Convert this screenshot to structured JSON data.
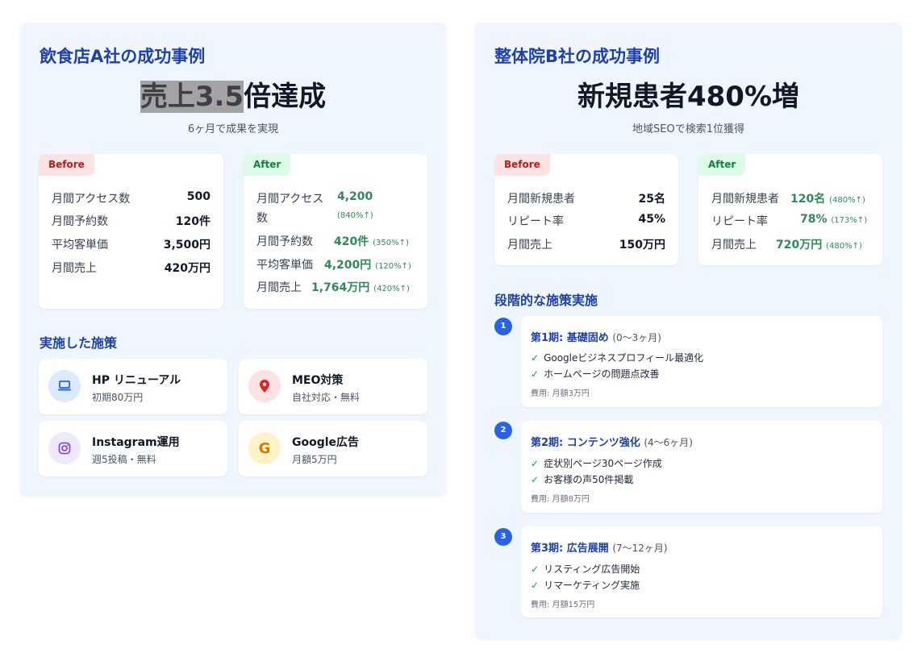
{
  "case_a": {
    "title": "飲食店A社の成功事例",
    "headline_highlight": "売上3.5",
    "headline_rest": "倍達成",
    "subline": "6ヶ月で成果を実現",
    "before": {
      "badge": "Before",
      "rows": [
        {
          "label": "月間アクセス数",
          "value": "500"
        },
        {
          "label": "月間予約数",
          "value": "120件"
        },
        {
          "label": "平均客単価",
          "value": "3,500円"
        },
        {
          "label": "月間売上",
          "value": "420万円"
        }
      ]
    },
    "after": {
      "badge": "After",
      "rows": [
        {
          "label_line1": "月間アクセス",
          "label_line2": "数",
          "value": "4,200",
          "pct": "(840%↑)"
        },
        {
          "label": "月間予約数",
          "value": "420件",
          "pct": "(350%↑)"
        },
        {
          "label": "平均客単価",
          "value": "4,200円",
          "pct": "(120%↑)"
        },
        {
          "label": "月間売上",
          "value": "1,764万円",
          "pct": "(420%↑)"
        }
      ]
    },
    "measures_title": "実施した施策",
    "measures": [
      {
        "name": "HP リニューアル",
        "desc": "初期80万円",
        "icon": "laptop-icon",
        "icon_bg": "#dbeafe",
        "icon_color": "#2563eb"
      },
      {
        "name": "MEO対策",
        "desc": "自社対応・無料",
        "icon": "map-pin-icon",
        "icon_bg": "#fde2e2",
        "icon_color": "#dc2626"
      },
      {
        "name": "Instagram運用",
        "desc": "週5投稿・無料",
        "icon": "instagram-icon",
        "icon_bg": "#ede9fe",
        "icon_color": "#7c3aed"
      },
      {
        "name": "Google広告",
        "desc": "月額5万円",
        "icon": "google-icon",
        "icon_bg": "#fef3c7",
        "icon_color": "#d97706",
        "icon_glyph": "G"
      }
    ]
  },
  "case_b": {
    "title": "整体院B社の成功事例",
    "headline": "新規患者480%増",
    "subline": "地域SEOで検索1位獲得",
    "before": {
      "badge": "Before",
      "rows": [
        {
          "label": "月間新規患者",
          "value": "25名"
        },
        {
          "label": "リピート率",
          "value": "45%"
        },
        {
          "label": "月間売上",
          "value": "150万円"
        }
      ]
    },
    "after": {
      "badge": "After",
      "rows": [
        {
          "label": "月間新規患者",
          "value": "120名",
          "pct": "(480%↑)"
        },
        {
          "label": "リピート率",
          "value": "78%",
          "pct": "(173%↑)"
        },
        {
          "label": "月間売上",
          "value": "720万円",
          "pct": "(480%↑)"
        }
      ]
    },
    "steps_title": "段階的な施策実施",
    "steps": [
      {
        "num": "1",
        "title": "第1期: 基礎固め",
        "period": "(0〜3ヶ月)",
        "items": [
          "Googleビジネスプロフィール最適化",
          "ホームページの問題点改善"
        ],
        "cost": "費用: 月額3万円"
      },
      {
        "num": "2",
        "title": "第2期: コンテンツ強化",
        "period": "(4〜6ヶ月)",
        "items": [
          "症状別ページ30ページ作成",
          "お客様の声50件掲載"
        ],
        "cost": "費用: 月額8万円"
      },
      {
        "num": "3",
        "title": "第3期: 広告展開",
        "period": "(7〜12ヶ月)",
        "items": [
          "リスティング広告開始",
          "リマーケティング実施"
        ],
        "cost": "費用: 月額15万円"
      }
    ]
  }
}
